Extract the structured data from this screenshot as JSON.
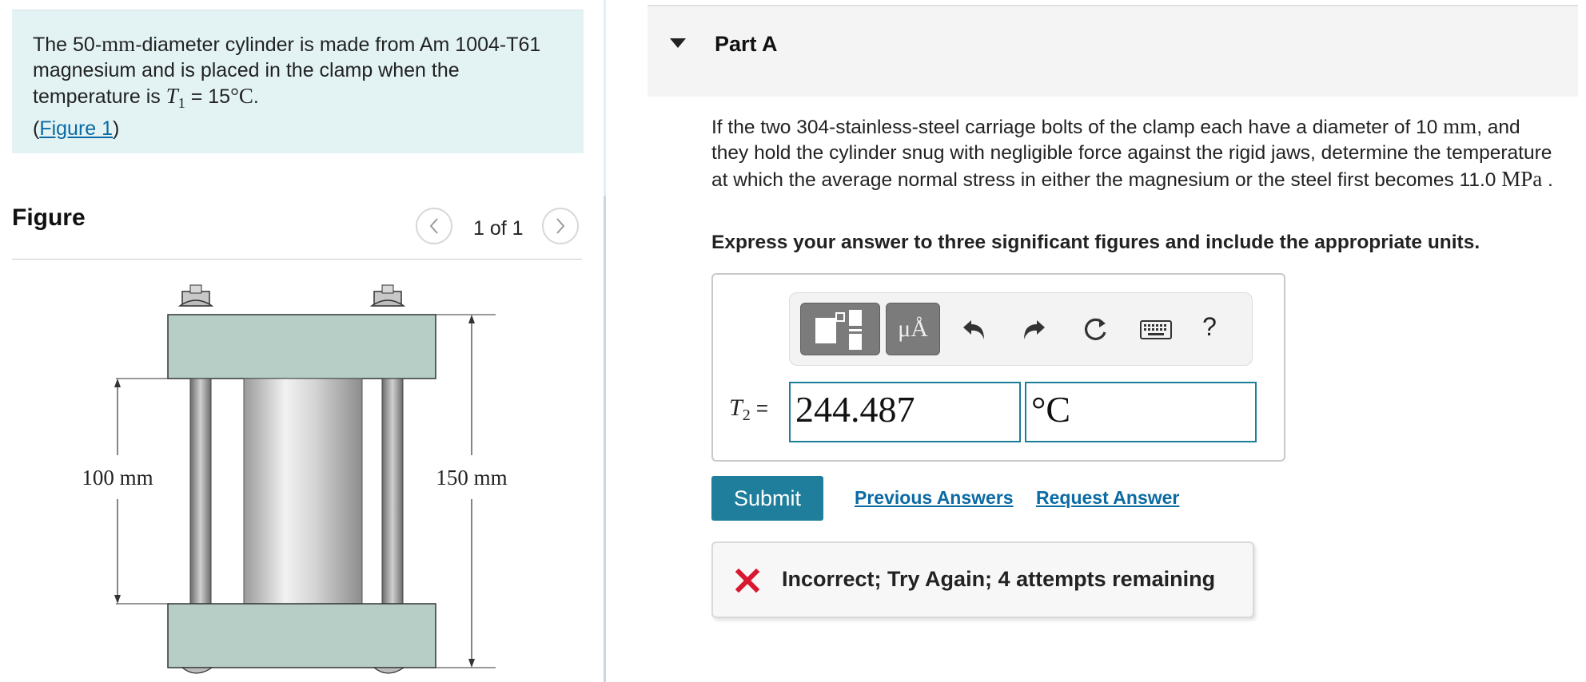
{
  "problem": {
    "intro_part1": "The 50-",
    "intro_mm": "mm",
    "intro_part2": "-diameter cylinder is made from Am 1004-T61 magnesium and is placed in the clamp when the temperature is ",
    "intro_t1": "T",
    "intro_t1_sub": "1",
    "intro_eq": " = 15",
    "intro_deg": "°C",
    "intro_end": ".",
    "figure_link_open": "(",
    "figure_link": "Figure 1",
    "figure_link_close": ")"
  },
  "figure_panel": {
    "title": "Figure",
    "pager": "1 of 1",
    "prev_icon": "chevron-left-icon",
    "next_icon": "chevron-right-icon",
    "dim_left": "100 mm",
    "dim_right": "150 mm"
  },
  "part": {
    "title": "Part A",
    "question_1": "If the two 304-stainless-steel carriage bolts of the clamp each have a diameter of 10 ",
    "question_mm": "mm",
    "question_2": ", and they hold the cylinder snug with negligible force against the rigid jaws, determine the temperature at which the average normal stress in either the magnesium or the steel first becomes 11.0 ",
    "question_mpa": "MPa",
    "question_3": " .",
    "instruction": "Express your answer to three significant figures and include the appropriate units."
  },
  "answer": {
    "symbols_label": "μÅ",
    "help_label": "?",
    "var_symbol": "T",
    "var_sub": "2",
    "equals": "=",
    "value": "244.487",
    "unit": "°C"
  },
  "actions": {
    "submit": "Submit",
    "previous_answers": "Previous Answers",
    "request_answer": "Request Answer"
  },
  "feedback": {
    "text": "Incorrect; Try Again; 4 attempts remaining",
    "icon": "x-icon",
    "color": "#d9172f"
  },
  "colors": {
    "accent": "#1f7e9c",
    "link": "#0b6aa4",
    "intro_bg": "#e3f3f4",
    "plate": "#b7cec7"
  }
}
